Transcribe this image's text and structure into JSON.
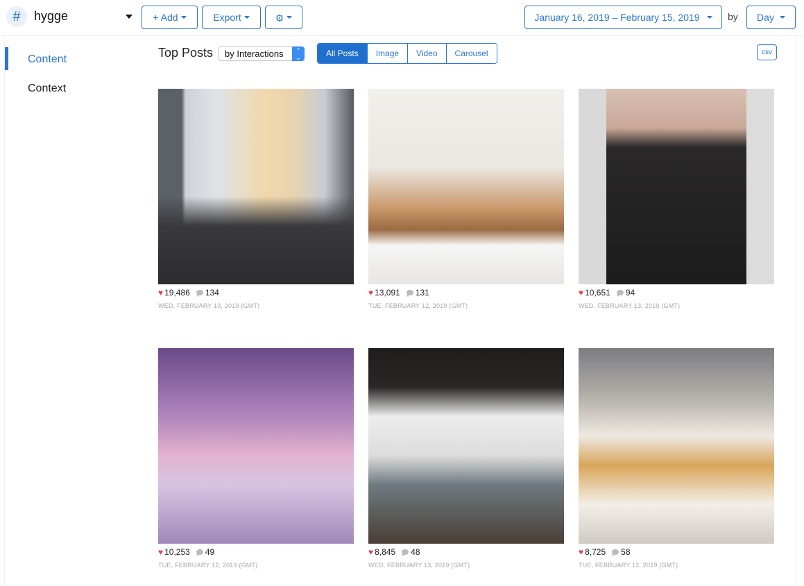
{
  "header": {
    "hashtag_icon": "#",
    "hashtag": "hygge",
    "add_label": "+ Add",
    "export_label": "Export",
    "settings_icon": "gear-icon",
    "date_range": "January 16, 2019 – February 15, 2019",
    "by_label": "by",
    "granularity": "Day"
  },
  "sidebar": {
    "items": [
      {
        "label": "Content",
        "active": true
      },
      {
        "label": "Context",
        "active": false
      }
    ]
  },
  "main": {
    "title": "Top Posts",
    "sort_select": "by Interactions",
    "filters": [
      {
        "label": "All Posts",
        "active": true
      },
      {
        "label": "Image",
        "active": false
      },
      {
        "label": "Video",
        "active": false
      },
      {
        "label": "Carousel",
        "active": false
      }
    ],
    "csv_label": "csv",
    "posts": [
      {
        "likes": "19,486",
        "comments": "134",
        "date": "WED, FEBRUARY 13, 2019 (GMT)",
        "image": "living room with snowy mountain view"
      },
      {
        "likes": "13,091",
        "comments": "131",
        "date": "TUE, FEBRUARY 12, 2019 (GMT)",
        "image": "white kitchen with wooden countertop"
      },
      {
        "likes": "10,651",
        "comments": "94",
        "date": "WED, FEBRUARY 13, 2019 (GMT)",
        "image": "person in black jeans holding dried flowers"
      },
      {
        "likes": "10,253",
        "comments": "49",
        "date": "TUE, FEBRUARY 12, 2019 (GMT)",
        "image": "snowy cabin at purple dusk"
      },
      {
        "likes": "8,845",
        "comments": "48",
        "date": "WED, FEBRUARY 13, 2019 (GMT)",
        "image": "bathroom with tub and candles"
      },
      {
        "likes": "8,725",
        "comments": "58",
        "date": "TUE, FEBRUARY 12, 2019 (GMT)",
        "image": "coffee, donut and candles on table"
      }
    ]
  }
}
